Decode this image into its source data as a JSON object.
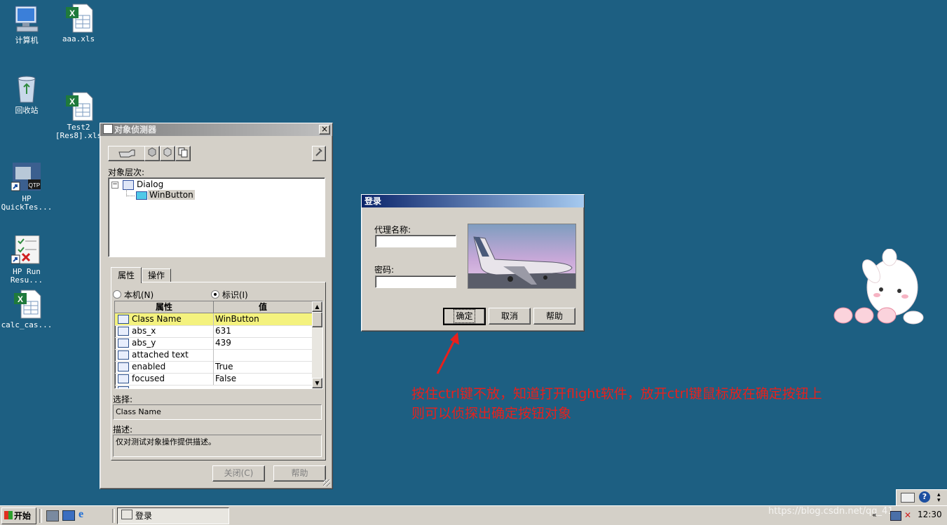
{
  "desktop": {
    "icons": [
      {
        "name": "computer",
        "label": "计算机"
      },
      {
        "name": "aaa-xls",
        "label": "aaa.xls"
      },
      {
        "name": "recycle-bin",
        "label": "回收站"
      },
      {
        "name": "test2-xls",
        "label": "Test2\n[Res8].xls"
      },
      {
        "name": "hp-quicktest",
        "label": "HP\nQuickTes..."
      },
      {
        "name": "hp-run-results",
        "label": "HP Run\nResu..."
      },
      {
        "name": "calc-cas",
        "label": "calc_cas..."
      }
    ]
  },
  "spy": {
    "title": "对象侦测器",
    "hierarchy_label": "对象层次:",
    "tree": {
      "root": "Dialog",
      "child": "WinButton"
    },
    "tabs": [
      "属性",
      "操作"
    ],
    "radio_native": "本机(N)",
    "radio_identify": "标识(I)",
    "grid_headers": [
      "属性",
      "值"
    ],
    "rows": [
      {
        "prop": "Class Name",
        "value": "WinButton"
      },
      {
        "prop": "abs_x",
        "value": "631"
      },
      {
        "prop": "abs_y",
        "value": "439"
      },
      {
        "prop": "attached text",
        "value": ""
      },
      {
        "prop": "enabled",
        "value": "True"
      },
      {
        "prop": "focused",
        "value": "False"
      }
    ],
    "select_label": "选择:",
    "select_value": "Class Name",
    "desc_label": "描述:",
    "desc_value": "仅对测试对象操作提供描述。",
    "close_btn": "关闭(C)",
    "help_btn": "帮助"
  },
  "login": {
    "title": "登录",
    "agent_label": "代理名称:",
    "password_label": "密码:",
    "ok_btn": "确定",
    "cancel_btn": "取消",
    "help_btn": "帮助"
  },
  "annotation": {
    "line1": "按住ctrl键不放，知道打开flight软件，放开ctrl键鼠标放在确定按钮上",
    "line2": "则可以侦探出确定按钮对象",
    "color": "#e8201c"
  },
  "taskbar": {
    "start": "开始",
    "task_label": "登录",
    "clock": "12:30",
    "watermark": "https://blog.csdn.net/qq_41..."
  }
}
